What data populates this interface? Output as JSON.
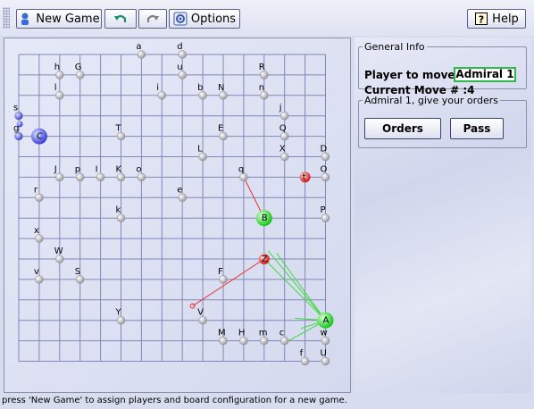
{
  "toolbar": {
    "new_game_label": "New Game",
    "undo_icon": "undo-arrow-icon",
    "redo_icon": "redo-arrow-icon",
    "options_label": "Options",
    "help_label": "Help"
  },
  "general_info": {
    "title": "General Info",
    "player_to_move_label": "Player to move:",
    "player_to_move": "Admiral 1",
    "current_move_label": "Current Move # :",
    "current_move": "4"
  },
  "orders_panel": {
    "title": "Admiral 1, give your orders",
    "orders_label": "Orders",
    "pass_label": "Pass"
  },
  "status_text": "press 'New Game' to assign players and board configuration for a new game.",
  "colors": {
    "player_green": "#2ee02e",
    "enemy_red": "#e82a2a",
    "fleet_blue": "#4f58e8",
    "planet_gray": "#c8c8c8"
  },
  "board": {
    "columns": 15,
    "rows": 15,
    "planets": [
      {
        "name": "a",
        "col": 6,
        "row": 0
      },
      {
        "name": "d",
        "col": 8,
        "row": 0
      },
      {
        "name": "u",
        "col": 8,
        "row": 1
      },
      {
        "name": "R",
        "col": 12,
        "row": 1
      },
      {
        "name": "h",
        "col": 2,
        "row": 1
      },
      {
        "name": "G",
        "col": 3,
        "row": 1
      },
      {
        "name": "l",
        "col": 2,
        "row": 2
      },
      {
        "name": "i",
        "col": 7,
        "row": 2
      },
      {
        "name": "b",
        "col": 9,
        "row": 2
      },
      {
        "name": "N",
        "col": 10,
        "row": 2
      },
      {
        "name": "n",
        "col": 12,
        "row": 2
      },
      {
        "name": "j",
        "col": 13,
        "row": 3
      },
      {
        "name": "s",
        "col": 0,
        "row": 3
      },
      {
        "name": "g",
        "col": 0,
        "row": 4
      },
      {
        "name": "C",
        "col": 1,
        "row": 4
      },
      {
        "name": "T",
        "col": 5,
        "row": 4
      },
      {
        "name": "E",
        "col": 10,
        "row": 4
      },
      {
        "name": "Q",
        "col": 13,
        "row": 4
      },
      {
        "name": "L",
        "col": 9,
        "row": 5
      },
      {
        "name": "X",
        "col": 13,
        "row": 5
      },
      {
        "name": "D",
        "col": 15,
        "row": 5
      },
      {
        "name": "J",
        "col": 2,
        "row": 6
      },
      {
        "name": "p",
        "col": 3,
        "row": 6
      },
      {
        "name": "I",
        "col": 4,
        "row": 6
      },
      {
        "name": "K",
        "col": 5,
        "row": 6
      },
      {
        "name": "o",
        "col": 6,
        "row": 6
      },
      {
        "name": "q",
        "col": 11,
        "row": 6
      },
      {
        "name": "t",
        "col": 14,
        "row": 6
      },
      {
        "name": "O",
        "col": 15,
        "row": 6
      },
      {
        "name": "r",
        "col": 1,
        "row": 7
      },
      {
        "name": "e",
        "col": 8,
        "row": 7
      },
      {
        "name": "k",
        "col": 5,
        "row": 8
      },
      {
        "name": "B",
        "col": 12,
        "row": 8
      },
      {
        "name": "P",
        "col": 15,
        "row": 8
      },
      {
        "name": "x",
        "col": 1,
        "row": 9
      },
      {
        "name": "W",
        "col": 2,
        "row": 10
      },
      {
        "name": "Z",
        "col": 12,
        "row": 10
      },
      {
        "name": "F",
        "col": 10,
        "row": 11
      },
      {
        "name": "v",
        "col": 1,
        "row": 11
      },
      {
        "name": "S",
        "col": 3,
        "row": 11
      },
      {
        "name": "Y",
        "col": 5,
        "row": 13
      },
      {
        "name": "V",
        "col": 9,
        "row": 13
      },
      {
        "name": "A",
        "col": 15,
        "row": 13
      },
      {
        "name": "M",
        "col": 10,
        "row": 14
      },
      {
        "name": "H",
        "col": 11,
        "row": 14
      },
      {
        "name": "m",
        "col": 12,
        "row": 14
      },
      {
        "name": "c",
        "col": 13,
        "row": 14
      },
      {
        "name": "w",
        "col": 15,
        "row": 14
      },
      {
        "name": "f",
        "col": 14,
        "row": 15
      },
      {
        "name": "U",
        "col": 15,
        "row": 15
      }
    ],
    "owned_planets": [
      {
        "name": "A",
        "owner": "green"
      },
      {
        "name": "B",
        "owner": "green"
      },
      {
        "name": "Z",
        "owner": "red"
      },
      {
        "name": "t",
        "owner": "red"
      },
      {
        "name": "C",
        "owner": "blue"
      }
    ]
  }
}
